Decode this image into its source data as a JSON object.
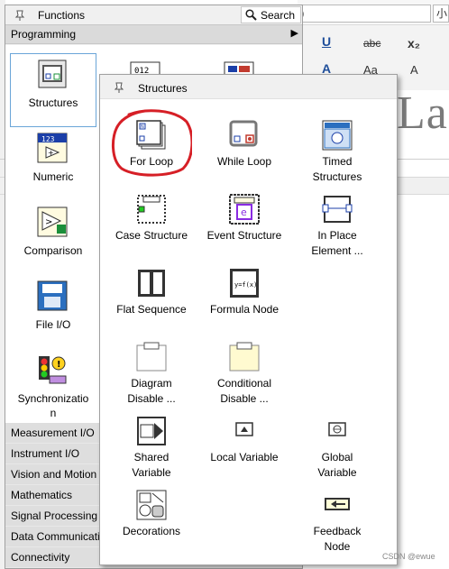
{
  "background": {
    "font_box": "）",
    "size_box": "小",
    "ribbon": {
      "underline": "U",
      "strike": "abc",
      "subscript": "x₂",
      "font_color": "A",
      "change_case": "Aa",
      "grow": "A"
    },
    "doc_text": "Lac"
  },
  "functions_palette": {
    "title": "Functions",
    "search_label": "Search",
    "programming_label": "Programming",
    "items": [
      {
        "label": "Structures",
        "icon": "structures-icon"
      },
      {
        "label": "Numeric",
        "icon": "numeric-icon"
      },
      {
        "label": "Comparison",
        "icon": "comparison-icon"
      },
      {
        "label": "File I/O",
        "icon": "file-io-icon"
      },
      {
        "label": "Synchronizatio\nn",
        "icon": "synchronization-icon"
      }
    ],
    "categories": [
      "Measurement I/O",
      "Instrument I/O",
      "Vision and Motion",
      "Mathematics",
      "Signal Processing",
      "Data Communication",
      "Connectivity"
    ]
  },
  "structures_palette": {
    "title": "Structures",
    "items": [
      {
        "label": "For Loop",
        "icon": "for-loop-icon"
      },
      {
        "label": "While Loop",
        "icon": "while-loop-icon"
      },
      {
        "label": "Timed\nStructures",
        "icon": "timed-structures-icon"
      },
      {
        "label": "Case Structure",
        "icon": "case-structure-icon"
      },
      {
        "label": "Event Structure",
        "icon": "event-structure-icon"
      },
      {
        "label": "In Place\nElement ...",
        "icon": "in-place-element-icon"
      },
      {
        "label": "Flat Sequence",
        "icon": "flat-sequence-icon"
      },
      {
        "label": "Formula Node",
        "icon": "formula-node-icon"
      },
      {
        "label": "Diagram\nDisable ...",
        "icon": "diagram-disable-icon"
      },
      {
        "label": "Conditional\nDisable ...",
        "icon": "conditional-disable-icon"
      },
      {
        "label": "Shared\nVariable",
        "icon": "shared-variable-icon"
      },
      {
        "label": "Local Variable",
        "icon": "local-variable-icon"
      },
      {
        "label": "Global\nVariable",
        "icon": "global-variable-icon"
      },
      {
        "label": "Decorations",
        "icon": "decorations-icon"
      },
      {
        "label": "Feedback\nNode",
        "icon": "feedback-node-icon"
      }
    ]
  },
  "watermark": "CSDN @ewue",
  "colors": {
    "highlight_red": "#d61f26",
    "selection_blue": "#6aa5d8"
  }
}
